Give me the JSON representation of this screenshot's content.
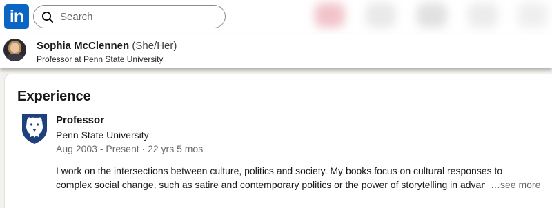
{
  "nav": {
    "logo_text": "in",
    "search_placeholder": "Search",
    "brand_color": "#0a66c2"
  },
  "profile": {
    "name": "Sophia McClennen",
    "pronouns": "(She/Her)",
    "headline": "Professor at Penn State University"
  },
  "experience": {
    "section_title": "Experience",
    "items": [
      {
        "title": "Professor",
        "company": "Penn State University",
        "dates": "Aug 2003 - Present · 22 yrs 5 mos",
        "description_line1": "I work on the intersections between culture, politics and society. My books focus on cultural responses to",
        "description_line2": "complex social change, such as satire and contemporary politics or the power of storytelling in advanc",
        "see_more_label": "…see more",
        "logo_icon": "penn-state-shield-icon"
      }
    ]
  }
}
